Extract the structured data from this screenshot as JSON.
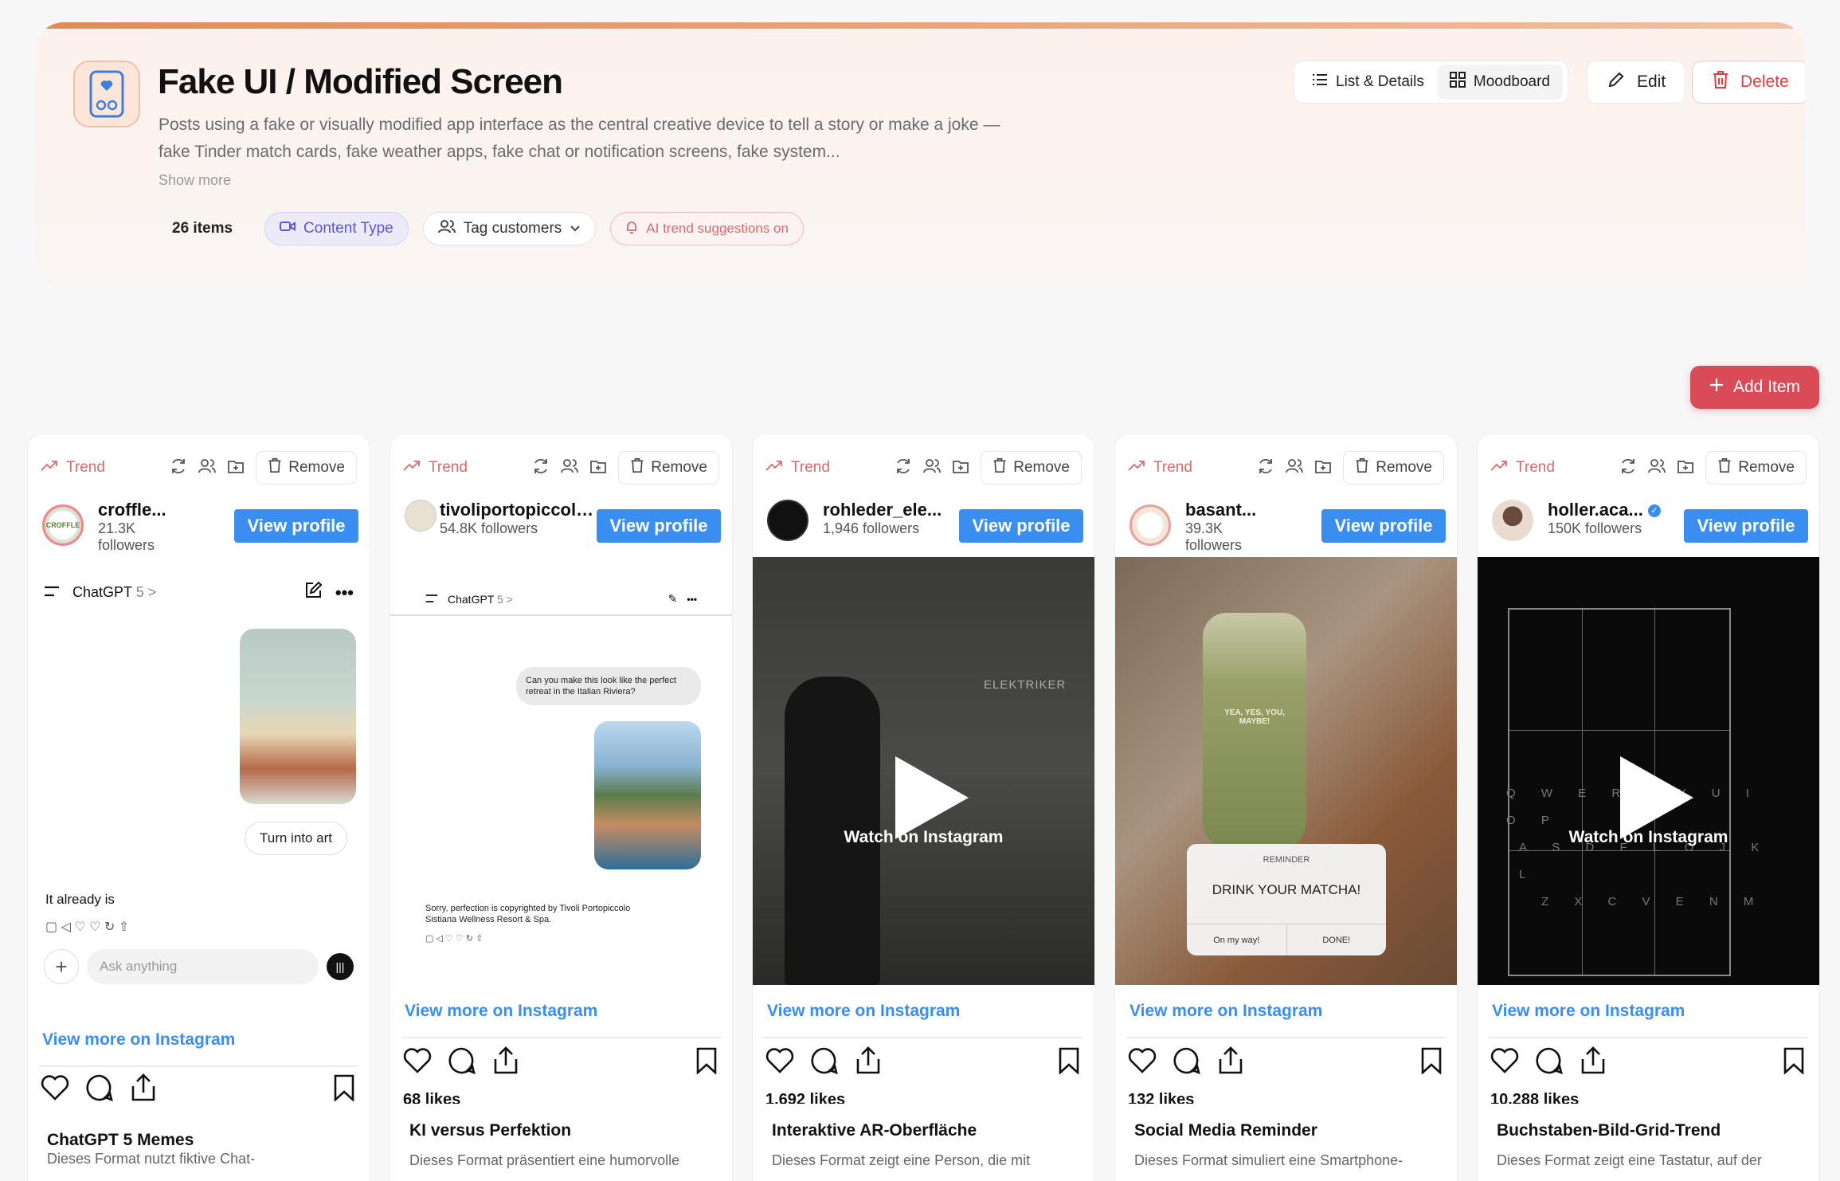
{
  "header": {
    "title": "Fake UI / Modified Screen",
    "description": "Posts using a fake or visually modified app interface as the central creative device to tell a story or make a joke — fake Tinder match cards, fake weather apps, fake chat or notification screens, fake system...",
    "show_more": "Show more",
    "item_count": "26 items",
    "content_type": "Content Type",
    "tag_customers": "Tag customers",
    "ai_trend": "AI trend suggestions on",
    "list_details": "List & Details",
    "moodboard": "Moodboard",
    "edit": "Edit",
    "delete": "Delete",
    "colors": {
      "accent": "#d94c57",
      "link": "#3a8ef0",
      "trend": "#d86a6a"
    }
  },
  "add_item": "Add Item",
  "card_common": {
    "trend": "Trend",
    "remove": "Remove",
    "view_profile": "View profile",
    "view_more": "View more on Instagram",
    "watch": "Watch on Instagram"
  },
  "cards": [
    {
      "name": "croffle...",
      "followers": "21.3K followers",
      "likes": "",
      "title": "ChatGPT 5 Memes",
      "desc": "Dieses Format nutzt fiktive Chat-",
      "chat_app": "ChatGPT",
      "chat_version": "5 >",
      "chat_button": "Turn into art",
      "chat_reply": "It already is",
      "chat_input": "Ask anything"
    },
    {
      "name": "tivoliportopiccolo ar",
      "followers": "54.8K followers",
      "likes": "68 likes",
      "title": "KI versus Perfektion",
      "desc": "Dieses Format präsentiert eine humorvolle",
      "chat_app": "ChatGPT",
      "chat_version": "5 >",
      "chat_question": "Can you make this look like the perfect retreat in the Italian Riviera?",
      "chat_reply": "Sorry, perfection is copyrighted by Tivoli Portopiccolo Sistiana Wellness Resort & Spa."
    },
    {
      "name": "rohleder_ele...",
      "followers": "1,946 followers",
      "likes": "1,692 likes",
      "title": "Interaktive AR-Oberfläche",
      "desc": "Dieses Format zeigt eine Person, die mit",
      "overlay": "ELEKTRIKER"
    },
    {
      "name": "basant...",
      "followers": "39.3K followers",
      "likes": "132 likes",
      "title": "Social Media Reminder",
      "desc": "Dieses Format simuliert eine Smartphone-",
      "reminder_label": "REMINDER",
      "reminder_text": "DRINK YOUR MATCHA!",
      "reminder_left": "On my way!",
      "reminder_right": "DONE!",
      "cup_text": "YEA, YES, YOU, MAYBE!"
    },
    {
      "name": "holler.aca...",
      "followers": "150K followers",
      "likes": "10,288 likes",
      "title": "Buchstaben-Bild-Grid-Trend",
      "desc": "Dieses Format zeigt eine Tastatur, auf der",
      "keyboard_rows": [
        "Q W E R T Y U I O P",
        "A S D F L O J K L",
        "Z X C V E N M"
      ]
    }
  ]
}
